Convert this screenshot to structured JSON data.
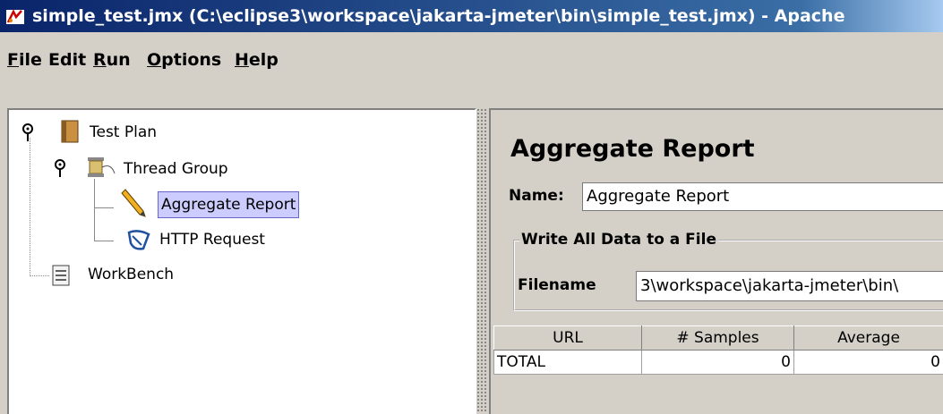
{
  "window": {
    "title": "simple_test.jmx (C:\\eclipse3\\workspace\\jakarta-jmeter\\bin\\simple_test.jmx) - Apache"
  },
  "menu": [
    {
      "label": "File",
      "mnemonic": "F",
      "rest": "ile"
    },
    {
      "label": "Edit",
      "mnemonic": "",
      "rest": "Edit"
    },
    {
      "label": "Run",
      "mnemonic": "R",
      "rest": "un"
    },
    {
      "label": "Options",
      "mnemonic": "O",
      "rest": "ptions"
    },
    {
      "label": "Help",
      "mnemonic": "H",
      "rest": "elp"
    }
  ],
  "tree": {
    "test_plan": "Test Plan",
    "thread_group": "Thread Group",
    "aggregate_report": "Aggregate Report",
    "http_request": "HTTP Request",
    "workbench": "WorkBench"
  },
  "panel": {
    "heading": "Aggregate Report",
    "name_label": "Name:",
    "name_value": "Aggregate Report",
    "group_title": "Write All Data to a File",
    "filename_label": "Filename",
    "filename_value": "3\\workspace\\jakarta-jmeter\\bin\\"
  },
  "table": {
    "headers": [
      "URL",
      "# Samples",
      "Average"
    ],
    "rows": [
      [
        "TOTAL",
        "0",
        "0"
      ]
    ]
  },
  "colors": {
    "selection": "#ccccff",
    "titlebar": "#0a246a"
  }
}
